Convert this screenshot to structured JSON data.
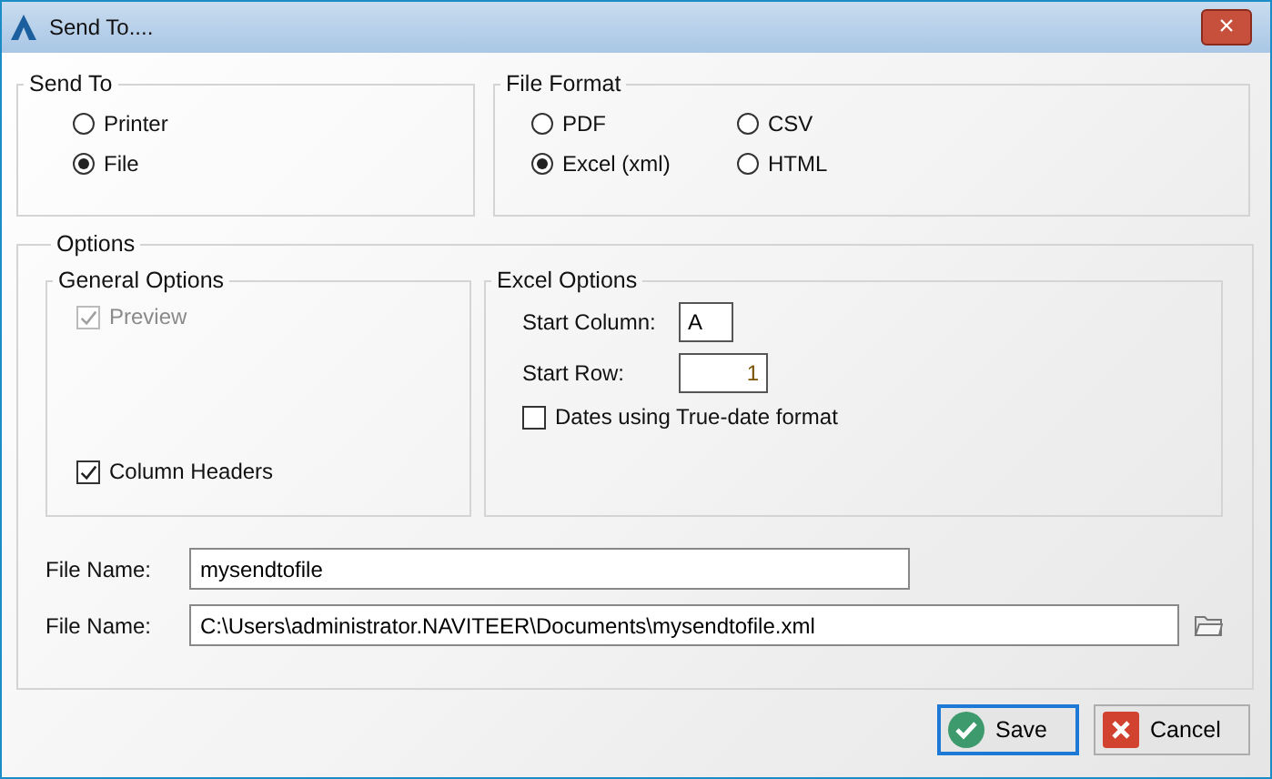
{
  "window": {
    "title": "Send To....",
    "close_label": "×"
  },
  "send_to": {
    "title": "Send To",
    "options": [
      {
        "label": "Printer",
        "selected": false
      },
      {
        "label": "File",
        "selected": true
      }
    ]
  },
  "file_format": {
    "title": "File Format",
    "options": [
      {
        "label": "PDF",
        "selected": false
      },
      {
        "label": "CSV",
        "selected": false
      },
      {
        "label": "Excel (xml)",
        "selected": true
      },
      {
        "label": "HTML",
        "selected": false
      }
    ]
  },
  "options": {
    "title": "Options",
    "general": {
      "title": "General Options",
      "checkboxes": [
        {
          "label": "Preview",
          "checked": true,
          "disabled": true
        },
        {
          "label": "Column Headers",
          "checked": true,
          "disabled": false
        }
      ]
    },
    "excel": {
      "title": "Excel Options",
      "fields": [
        {
          "label": "Start Column:",
          "value": "A",
          "kind": "text"
        },
        {
          "label": "Start Row:",
          "value": "1",
          "kind": "number"
        }
      ],
      "checkbox": {
        "label": "Dates using True-date format",
        "checked": false
      }
    },
    "file_fields": [
      {
        "label": "File Name:",
        "value": "mysendtofile",
        "kind": "plain"
      },
      {
        "label": "File Name:",
        "value": "C:\\Users\\administrator.NAVITEER\\Documents\\mysendtofile.xml",
        "kind": "browse"
      }
    ]
  },
  "buttons": [
    {
      "label": "Save",
      "kind": "save"
    },
    {
      "label": "Cancel",
      "kind": "cancel"
    }
  ]
}
